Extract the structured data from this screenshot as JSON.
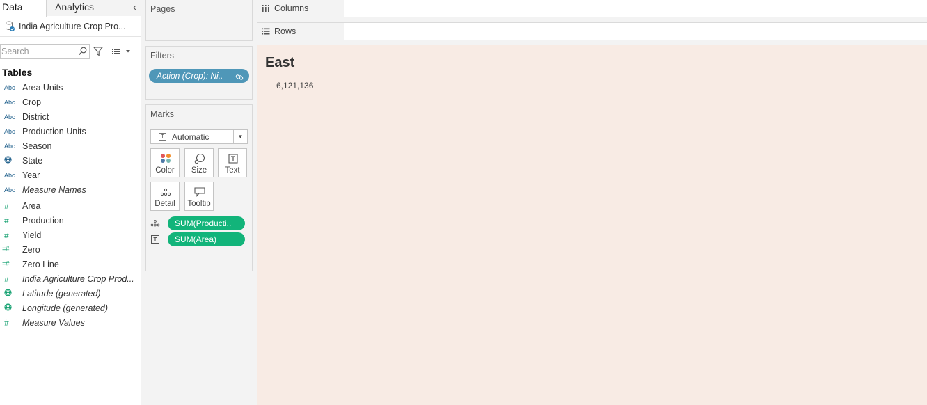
{
  "data_pane": {
    "tabs": [
      {
        "label": "Data",
        "active": true
      },
      {
        "label": "Analytics",
        "active": false
      }
    ],
    "datasource": "India Agriculture Crop Pro...",
    "search": {
      "placeholder": "Search",
      "value": ""
    },
    "tables_heading": "Tables",
    "dimensions": [
      {
        "icon": "Abc",
        "name": "Area Units"
      },
      {
        "icon": "Abc",
        "name": "Crop"
      },
      {
        "icon": "Abc",
        "name": "District"
      },
      {
        "icon": "Abc",
        "name": "Production Units"
      },
      {
        "icon": "Abc",
        "name": "Season"
      },
      {
        "icon": "globe-icon",
        "name": "State"
      },
      {
        "icon": "Abc",
        "name": "Year"
      },
      {
        "icon": "Abc",
        "name": "Measure Names"
      }
    ],
    "measures": [
      {
        "icon": "#",
        "name": "Area"
      },
      {
        "icon": "#",
        "name": "Production"
      },
      {
        "icon": "#",
        "name": "Yield"
      },
      {
        "icon": "=#",
        "name": "Zero"
      },
      {
        "icon": "=#",
        "name": "Zero Line"
      },
      {
        "icon": "#",
        "name": "India Agriculture Crop Prod..."
      },
      {
        "icon": "globe-icon",
        "name": "Latitude (generated)"
      },
      {
        "icon": "globe-icon",
        "name": "Longitude (generated)"
      },
      {
        "icon": "#",
        "name": "Measure Values"
      }
    ]
  },
  "pages_card": {
    "title": "Pages"
  },
  "filters_card": {
    "title": "Filters",
    "pills": [
      "Action (Crop): Ni.."
    ]
  },
  "marks_card": {
    "title": "Marks",
    "mark_type": "Automatic",
    "buttons": {
      "color": "Color",
      "size": "Size",
      "text": "Text",
      "detail": "Detail",
      "tooltip": "Tooltip"
    },
    "pills": [
      {
        "encoding": "detail-icon",
        "label": "SUM(Producti.."
      },
      {
        "encoding": "text-icon",
        "label": "SUM(Area)"
      }
    ]
  },
  "shelves": {
    "columns": "Columns",
    "rows": "Rows"
  },
  "viz": {
    "title": "East",
    "value": "6,121,136",
    "background": "#f8ebe4"
  },
  "colors": {
    "filter_pill": "#4f97b8",
    "measure_pill": "#12b47a",
    "dimension_icon": "#1f5f8b",
    "measure_icon": "#12a06f"
  }
}
